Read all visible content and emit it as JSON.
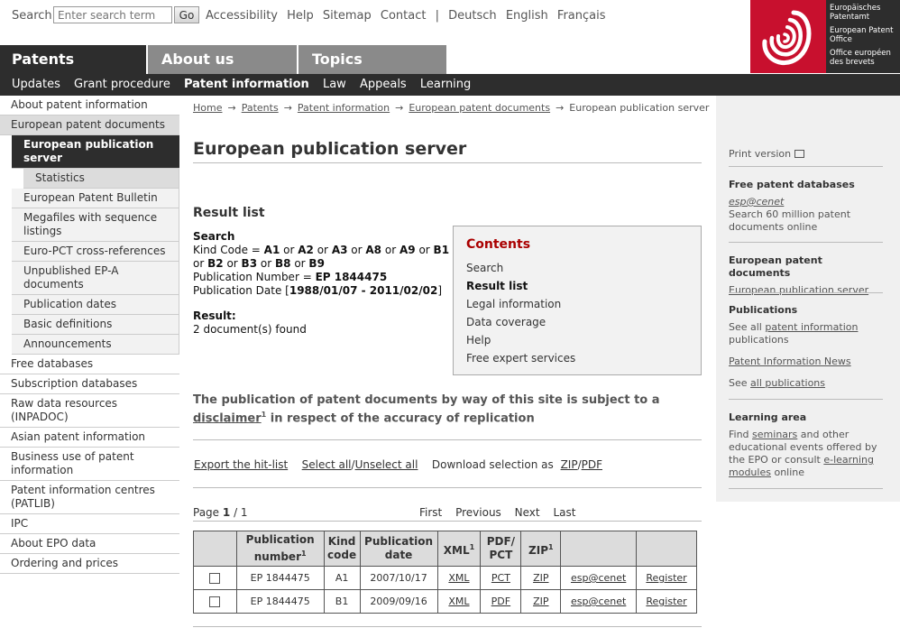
{
  "search": {
    "label": "Search",
    "placeholder": "Enter search term",
    "go_label": "Go"
  },
  "toplinks": [
    "Accessibility",
    "Help",
    "Sitemap",
    "Contact",
    "|",
    "Deutsch",
    "English",
    "Français"
  ],
  "logo": {
    "lines": [
      "Europäisches Patentamt",
      "European Patent Office",
      "Office européen des brevets"
    ]
  },
  "tabs": [
    "Patents",
    "About us",
    "Topics"
  ],
  "subnav": [
    "Updates",
    "Grant procedure",
    "Patent information",
    "Law",
    "Appeals",
    "Learning"
  ],
  "leftnav": [
    {
      "label": "About patent information",
      "level": 1
    },
    {
      "label": "European patent documents",
      "level": 1,
      "selected": true
    },
    {
      "label": "European publication server",
      "level": 2,
      "current": true
    },
    {
      "label": "Statistics",
      "level": 3
    },
    {
      "label": "European Patent Bulletin",
      "level": 2
    },
    {
      "label": "Megafiles with sequence listings",
      "level": 2
    },
    {
      "label": "Euro-PCT cross-references",
      "level": 2
    },
    {
      "label": "Unpublished EP-A documents",
      "level": 2
    },
    {
      "label": "Publication dates",
      "level": 2
    },
    {
      "label": "Basic definitions",
      "level": 2
    },
    {
      "label": "Announcements",
      "level": 2
    },
    {
      "label": "Free databases",
      "level": 1
    },
    {
      "label": "Subscription databases",
      "level": 1
    },
    {
      "label": "Raw data resources (INPADOC)",
      "level": 1
    },
    {
      "label": "Asian patent information",
      "level": 1
    },
    {
      "label": "Business use of patent information",
      "level": 1
    },
    {
      "label": "Patent information centres (PATLIB)",
      "level": 1
    },
    {
      "label": "IPC",
      "level": 1
    },
    {
      "label": "About EPO data",
      "level": 1
    },
    {
      "label": "Ordering and prices",
      "level": 1
    }
  ],
  "breadcrumb": [
    "Home",
    "Patents",
    "Patent information",
    "European patent documents",
    "European publication server"
  ],
  "breadcrumb_sep": "→",
  "page_title": "European publication server",
  "result_heading": "Result list",
  "search_block": {
    "title": "Search",
    "kind_code_label": "Kind Code = ",
    "kind_codes": [
      "A1",
      "A2",
      "A3",
      "A8",
      "A9",
      "B1",
      "B2",
      "B3",
      "B8",
      "B9"
    ],
    "or_word": "or",
    "publication_number_label": "Publication Number = ",
    "publication_number": "EP 1844475",
    "publication_date_label": "Publication Date [",
    "publication_date_range": "1988/01/07 - 2011/02/02",
    "publication_date_close": "]"
  },
  "result": {
    "label": "Result:",
    "count_text": "2 document(s) found"
  },
  "contents": {
    "title": "Contents",
    "items": [
      {
        "label": "Search"
      },
      {
        "label": "Result list",
        "current": true
      },
      {
        "label": "Legal information"
      },
      {
        "label": "Data coverage"
      },
      {
        "label": "Help"
      },
      {
        "label": "Free expert services"
      }
    ]
  },
  "disclaimer": {
    "before": "The publication of patent documents by way of this site is subject to a ",
    "link": "disclaimer",
    "sup": "1",
    "after": " in respect of the accuracy of replication"
  },
  "actions": {
    "export": "Export the hit-list",
    "select_all": "Select all",
    "slash": "/",
    "unselect_all": "Unselect all",
    "download_label": "Download selection as",
    "zip": "ZIP",
    "pdf": "PDF"
  },
  "pager": {
    "page_label": "Page",
    "page_current": "1",
    "page_total": "/ 1",
    "first": "First",
    "previous": "Previous",
    "next": "Next",
    "last": "Last"
  },
  "table": {
    "headers": [
      {
        "label": "",
        "sup": ""
      },
      {
        "label": "Publication number",
        "sup": "1"
      },
      {
        "label": "Kind code",
        "sup": ""
      },
      {
        "label": "Publication date",
        "sup": ""
      },
      {
        "label": "XML",
        "sup": "1"
      },
      {
        "label": "PDF/ PCT",
        "sup": ""
      },
      {
        "label": "ZIP",
        "sup": "1"
      },
      {
        "label": "",
        "sup": ""
      },
      {
        "label": "",
        "sup": ""
      }
    ],
    "rows": [
      {
        "number": "EP 1844475",
        "kind": "A1",
        "date": "2007/10/17",
        "xml": "XML",
        "doc": "PCT",
        "zip": "ZIP",
        "espacenet": "esp@cenet",
        "register": "Register"
      },
      {
        "number": "EP 1844475",
        "kind": "B1",
        "date": "2009/09/16",
        "xml": "XML",
        "doc": "PDF",
        "zip": "ZIP",
        "espacenet": "esp@cenet",
        "register": "Register"
      }
    ]
  },
  "rightbar": {
    "print_version": "Print version",
    "free_db": {
      "title": "Free patent databases",
      "link": "esp@cenet",
      "desc": "Search 60 million patent documents online"
    },
    "epd": {
      "title": "European patent documents",
      "link": "European publication server"
    },
    "publications": {
      "title": "Publications",
      "see_all_prefix": "See all ",
      "see_all_link": "patent information",
      "see_all_suffix": " publications",
      "news": "Patent Information News",
      "see_all2_prefix": "See ",
      "see_all2_link": "all publications"
    },
    "learning": {
      "title": "Learning area",
      "t1": "Find ",
      "seminars": "seminars",
      "t2": " and other educational events offered by the EPO or consult ",
      "elearning": "e-learning modules",
      "t3": " online"
    }
  },
  "colors": {
    "dark": "#2d2d2d",
    "tab_grey": "#8a8a8a",
    "brand_red": "#c8102e",
    "contents_title": "#aa0000"
  }
}
